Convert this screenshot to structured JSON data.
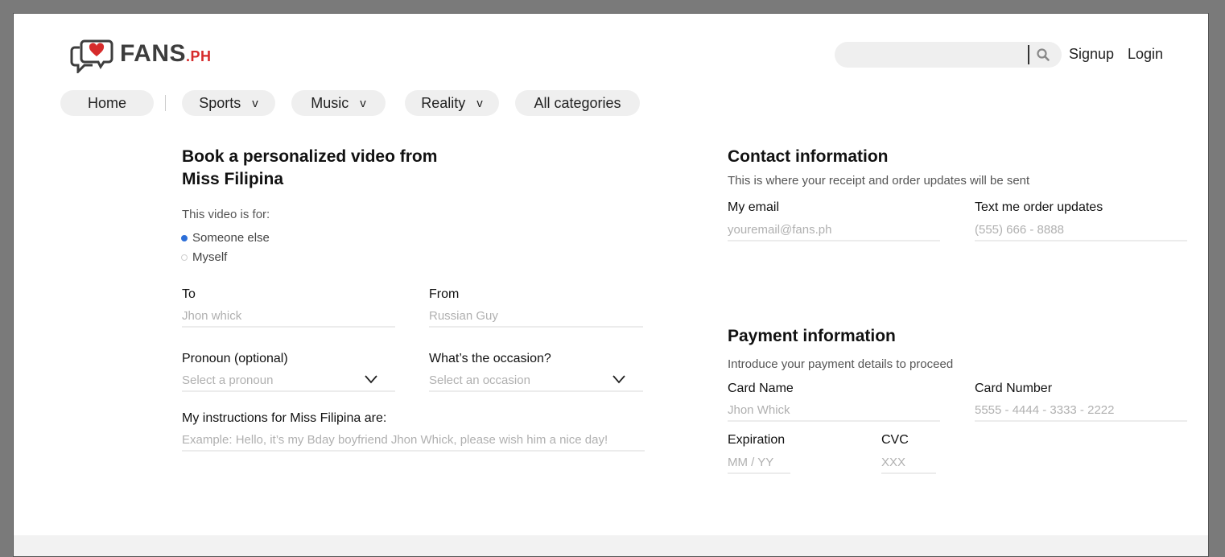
{
  "brand": {
    "name": "FANS",
    "suffix": ".PH"
  },
  "header": {
    "search": {
      "placeholder": ""
    },
    "signup_label": "Signup",
    "login_label": "Login"
  },
  "nav": {
    "home": "Home",
    "sports": "Sports",
    "music": "Music",
    "reality": "Reality",
    "all": "All categories",
    "chevron": "v"
  },
  "booking": {
    "title_line1": "Book a personalized video from",
    "title_line2": "Miss Filipina",
    "for_label": "This video is for:",
    "options": [
      "Someone else",
      "Myself"
    ],
    "to": {
      "label": "To",
      "placeholder": "Jhon whick"
    },
    "from": {
      "label": "From",
      "placeholder": "Russian Guy"
    },
    "pronoun": {
      "label": "Pronoun (optional)",
      "placeholder": "Select a pronoun"
    },
    "occasion": {
      "label": "What’s the occasion?",
      "placeholder": "Select an occasion"
    },
    "instructions": {
      "label": "My instructions for Miss Filipina are:",
      "placeholder": "Example: Hello, it’s my Bday boyfriend Jhon Whick, please wish him a nice day!"
    }
  },
  "contact": {
    "title": "Contact information",
    "subtitle": "This is where your receipt and order updates will be sent",
    "email": {
      "label": "My email",
      "placeholder": "youremail@fans.ph"
    },
    "phone": {
      "label": "Text me order updates",
      "placeholder": "(555) 666 - 8888"
    }
  },
  "payment": {
    "title": "Payment information",
    "subtitle": "Introduce your payment details to proceed",
    "card_name": {
      "label": "Card Name",
      "placeholder": "Jhon Whick"
    },
    "card_number": {
      "label": "Card Number",
      "placeholder": "5555 - 4444 - 3333 - 2222"
    },
    "expiration": {
      "label": "Expiration",
      "placeholder": "MM / YY"
    },
    "cvc": {
      "label": "CVC",
      "placeholder": "XXX"
    }
  },
  "colors": {
    "brand_red": "#d62b2b",
    "accent_blue": "#2c6ed8",
    "pill_bg": "#efefef"
  },
  "icons": {
    "logo": "chat-heart-icon",
    "search": "search-icon",
    "dropdown": "chevron-down-icon"
  }
}
